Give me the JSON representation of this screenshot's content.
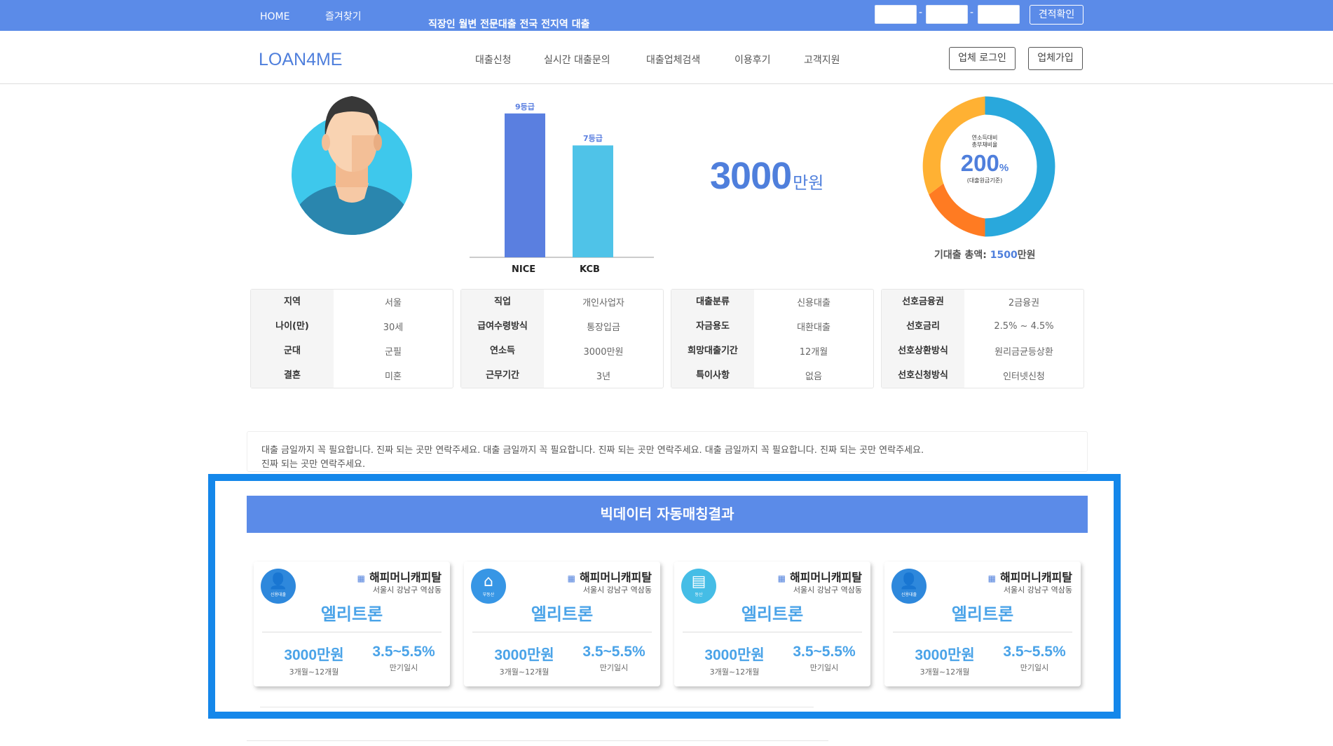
{
  "topbar": {
    "nav": [
      "HOME",
      "즐겨찾기"
    ],
    "slogan": "직장인 월변 전문대출 전국 전지역 대출",
    "dash": "-",
    "estimate_label": "견적확인"
  },
  "header": {
    "logo": "LOAN4ME",
    "menu": [
      "대출신청",
      "실시간 대출문의",
      "대출업체검색",
      "이용후기",
      "고객지원"
    ],
    "login_label": "업체 로그인",
    "join_label": "업체가입"
  },
  "credit": {
    "bars": [
      {
        "name": "NICE",
        "grade_label": "9등급",
        "value": 9
      },
      {
        "name": "KCB",
        "grade_label": "7등급",
        "value": 7
      }
    ]
  },
  "amount": {
    "number": "3000",
    "unit": "만원"
  },
  "ratio": {
    "caption_line1": "연소득대비",
    "caption_line2": "총부채비율",
    "value": "200",
    "unit": "%",
    "note": "(대출원금기준)",
    "total_label": "기대출 총액:",
    "total_value": "1500",
    "total_unit": "만원",
    "colors": {
      "primary": "#29a8dc",
      "secondary": "#ff7b22",
      "tertiary": "#ffb133"
    }
  },
  "info_tables": [
    [
      [
        "지역",
        "서울"
      ],
      [
        "나이(만)",
        "30세"
      ],
      [
        "군대",
        "군필"
      ],
      [
        "결혼",
        "미혼"
      ]
    ],
    [
      [
        "직업",
        "개인사업자"
      ],
      [
        "급여수령방식",
        "통장입금"
      ],
      [
        "연소득",
        "3000만원"
      ],
      [
        "근무기간",
        "3년"
      ]
    ],
    [
      [
        "대출분류",
        "신용대출"
      ],
      [
        "자금용도",
        "대환대출"
      ],
      [
        "희망대출기간",
        "12개월"
      ],
      [
        "특이사항",
        "없음"
      ]
    ],
    [
      [
        "선호금융권",
        "2금융권"
      ],
      [
        "선호금리",
        "2.5% ~ 4.5%"
      ],
      [
        "선호상환방식",
        "원리금균등상환"
      ],
      [
        "선호신청방식",
        "인터넷신청"
      ]
    ]
  ],
  "memo": {
    "line1": "대출 금일까지 꼭 필요합니다. 진짜 되는 곳만 연락주세요. 대출 금일까지 꼭 필요합니다. 진짜 되는 곳만 연락주세요. 대출 금일까지 꼭 필요합니다. 진짜 되는 곳만 연락주세요.",
    "line2": "진짜 되는 곳만 연락주세요."
  },
  "matching": {
    "title": "빅데이터 자동매칭결과",
    "cards": [
      {
        "icon": "person-icon",
        "glyph": "👤",
        "category": "신용대출",
        "color": "#2e88dc",
        "company": "해피머니캐피탈",
        "address": "서울시 강남구 역삼동",
        "product": "엘리트론",
        "limit": "3000만원",
        "period": "3개월~12개월",
        "rate": "3.5~5.5%",
        "repay": "만기일시"
      },
      {
        "icon": "house-icon",
        "glyph": "⌂",
        "category": "부동산",
        "color": "#3796e5",
        "company": "해피머니캐피탈",
        "address": "서울시 강남구 역삼동",
        "product": "엘리트론",
        "limit": "3000만원",
        "period": "3개월~12개월",
        "rate": "3.5~5.5%",
        "repay": "만기일시"
      },
      {
        "icon": "gold-bars-icon",
        "glyph": "▤",
        "category": "동산",
        "color": "#45bde6",
        "company": "해피머니캐피탈",
        "address": "서울시 강남구 역삼동",
        "product": "엘리트론",
        "limit": "3000만원",
        "period": "3개월~12개월",
        "rate": "3.5~5.5%",
        "repay": "만기일시"
      },
      {
        "icon": "person-icon",
        "glyph": "👤",
        "category": "신용대출",
        "color": "#2e88dc",
        "company": "해피머니캐피탈",
        "address": "서울시 강남구 역삼동",
        "product": "엘리트론",
        "limit": "3000만원",
        "period": "3개월~12개월",
        "rate": "3.5~5.5%",
        "repay": "만기일시"
      }
    ]
  }
}
